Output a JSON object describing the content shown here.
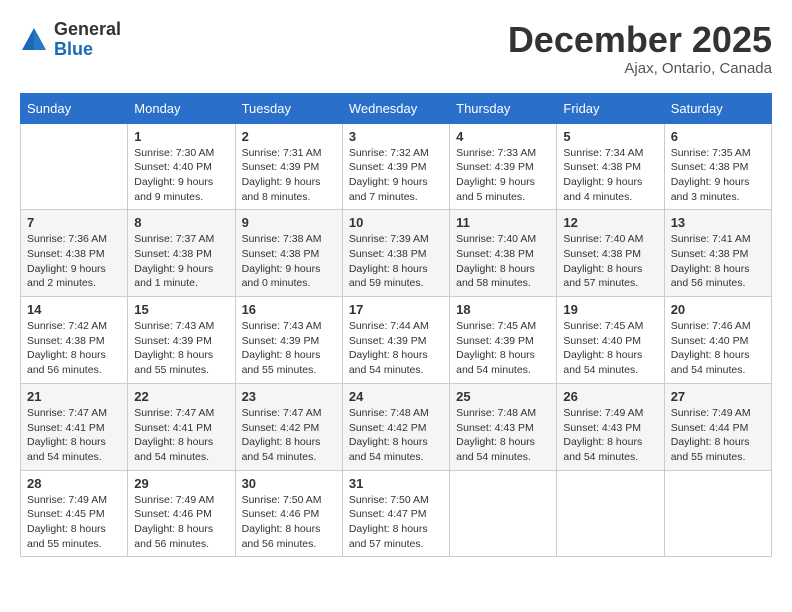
{
  "header": {
    "logo_line1": "General",
    "logo_line2": "Blue",
    "month": "December 2025",
    "location": "Ajax, Ontario, Canada"
  },
  "weekdays": [
    "Sunday",
    "Monday",
    "Tuesday",
    "Wednesday",
    "Thursday",
    "Friday",
    "Saturday"
  ],
  "weeks": [
    [
      {
        "num": "",
        "info": ""
      },
      {
        "num": "1",
        "info": "Sunrise: 7:30 AM\nSunset: 4:40 PM\nDaylight: 9 hours\nand 9 minutes."
      },
      {
        "num": "2",
        "info": "Sunrise: 7:31 AM\nSunset: 4:39 PM\nDaylight: 9 hours\nand 8 minutes."
      },
      {
        "num": "3",
        "info": "Sunrise: 7:32 AM\nSunset: 4:39 PM\nDaylight: 9 hours\nand 7 minutes."
      },
      {
        "num": "4",
        "info": "Sunrise: 7:33 AM\nSunset: 4:39 PM\nDaylight: 9 hours\nand 5 minutes."
      },
      {
        "num": "5",
        "info": "Sunrise: 7:34 AM\nSunset: 4:38 PM\nDaylight: 9 hours\nand 4 minutes."
      },
      {
        "num": "6",
        "info": "Sunrise: 7:35 AM\nSunset: 4:38 PM\nDaylight: 9 hours\nand 3 minutes."
      }
    ],
    [
      {
        "num": "7",
        "info": "Sunrise: 7:36 AM\nSunset: 4:38 PM\nDaylight: 9 hours\nand 2 minutes."
      },
      {
        "num": "8",
        "info": "Sunrise: 7:37 AM\nSunset: 4:38 PM\nDaylight: 9 hours\nand 1 minute."
      },
      {
        "num": "9",
        "info": "Sunrise: 7:38 AM\nSunset: 4:38 PM\nDaylight: 9 hours\nand 0 minutes."
      },
      {
        "num": "10",
        "info": "Sunrise: 7:39 AM\nSunset: 4:38 PM\nDaylight: 8 hours\nand 59 minutes."
      },
      {
        "num": "11",
        "info": "Sunrise: 7:40 AM\nSunset: 4:38 PM\nDaylight: 8 hours\nand 58 minutes."
      },
      {
        "num": "12",
        "info": "Sunrise: 7:40 AM\nSunset: 4:38 PM\nDaylight: 8 hours\nand 57 minutes."
      },
      {
        "num": "13",
        "info": "Sunrise: 7:41 AM\nSunset: 4:38 PM\nDaylight: 8 hours\nand 56 minutes."
      }
    ],
    [
      {
        "num": "14",
        "info": "Sunrise: 7:42 AM\nSunset: 4:38 PM\nDaylight: 8 hours\nand 56 minutes."
      },
      {
        "num": "15",
        "info": "Sunrise: 7:43 AM\nSunset: 4:39 PM\nDaylight: 8 hours\nand 55 minutes."
      },
      {
        "num": "16",
        "info": "Sunrise: 7:43 AM\nSunset: 4:39 PM\nDaylight: 8 hours\nand 55 minutes."
      },
      {
        "num": "17",
        "info": "Sunrise: 7:44 AM\nSunset: 4:39 PM\nDaylight: 8 hours\nand 54 minutes."
      },
      {
        "num": "18",
        "info": "Sunrise: 7:45 AM\nSunset: 4:39 PM\nDaylight: 8 hours\nand 54 minutes."
      },
      {
        "num": "19",
        "info": "Sunrise: 7:45 AM\nSunset: 4:40 PM\nDaylight: 8 hours\nand 54 minutes."
      },
      {
        "num": "20",
        "info": "Sunrise: 7:46 AM\nSunset: 4:40 PM\nDaylight: 8 hours\nand 54 minutes."
      }
    ],
    [
      {
        "num": "21",
        "info": "Sunrise: 7:47 AM\nSunset: 4:41 PM\nDaylight: 8 hours\nand 54 minutes."
      },
      {
        "num": "22",
        "info": "Sunrise: 7:47 AM\nSunset: 4:41 PM\nDaylight: 8 hours\nand 54 minutes."
      },
      {
        "num": "23",
        "info": "Sunrise: 7:47 AM\nSunset: 4:42 PM\nDaylight: 8 hours\nand 54 minutes."
      },
      {
        "num": "24",
        "info": "Sunrise: 7:48 AM\nSunset: 4:42 PM\nDaylight: 8 hours\nand 54 minutes."
      },
      {
        "num": "25",
        "info": "Sunrise: 7:48 AM\nSunset: 4:43 PM\nDaylight: 8 hours\nand 54 minutes."
      },
      {
        "num": "26",
        "info": "Sunrise: 7:49 AM\nSunset: 4:43 PM\nDaylight: 8 hours\nand 54 minutes."
      },
      {
        "num": "27",
        "info": "Sunrise: 7:49 AM\nSunset: 4:44 PM\nDaylight: 8 hours\nand 55 minutes."
      }
    ],
    [
      {
        "num": "28",
        "info": "Sunrise: 7:49 AM\nSunset: 4:45 PM\nDaylight: 8 hours\nand 55 minutes."
      },
      {
        "num": "29",
        "info": "Sunrise: 7:49 AM\nSunset: 4:46 PM\nDaylight: 8 hours\nand 56 minutes."
      },
      {
        "num": "30",
        "info": "Sunrise: 7:50 AM\nSunset: 4:46 PM\nDaylight: 8 hours\nand 56 minutes."
      },
      {
        "num": "31",
        "info": "Sunrise: 7:50 AM\nSunset: 4:47 PM\nDaylight: 8 hours\nand 57 minutes."
      },
      {
        "num": "",
        "info": ""
      },
      {
        "num": "",
        "info": ""
      },
      {
        "num": "",
        "info": ""
      }
    ]
  ]
}
